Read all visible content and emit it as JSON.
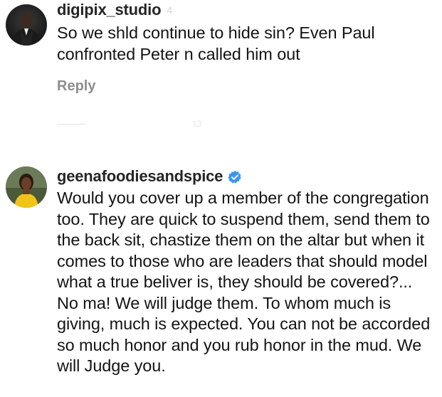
{
  "comments": [
    {
      "username": "digipix_studio",
      "time": "4",
      "text": "So we shld continue to hide sin? Even Paul confronted Peter n called him out",
      "reply_label": "Reply",
      "view_replies_label": "13",
      "avatar_icon": "avatar-man-dark-suit"
    },
    {
      "username": "geenafoodiesandspice",
      "verified": true,
      "verified_icon": "verified-badge-icon",
      "time": "",
      "text": "Would you cover up a member of the congregation too. They are quick to suspend them, send them to the back sit, chastize them on the altar but when it comes to those who are leaders that should model what a true beliver is, they should be covered?... No ma! We will judge them. To whom much is giving, much is expected. You can not be accorded so much honor and you rub honor in the mud. We will Judge you.",
      "avatar_icon": "avatar-woman-yellow-top"
    }
  ],
  "colors": {
    "username": "#262626",
    "text": "#141414",
    "muted": "#8e8e8e",
    "verified": "#3897f0"
  }
}
